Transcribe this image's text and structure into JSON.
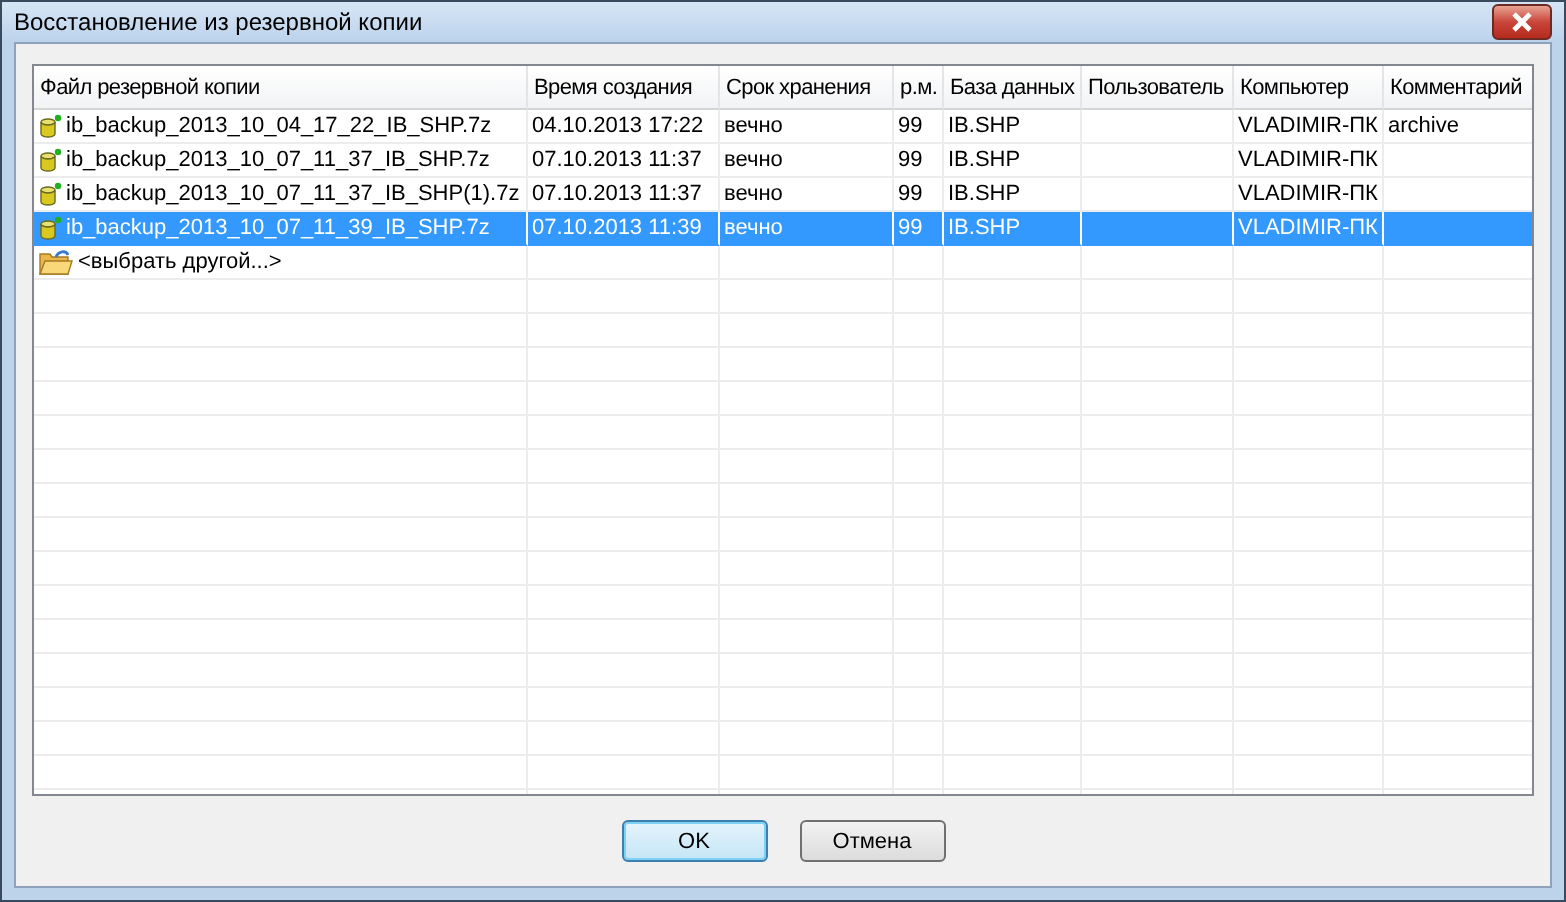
{
  "window": {
    "title": "Восстановление из резервной копии"
  },
  "table": {
    "columns": [
      "Файл резервной копии",
      "Время создания",
      "Срок хранения",
      "р.м.",
      "База данных",
      "Пользователь",
      "Компьютер",
      "Комментарий"
    ],
    "rows": [
      {
        "kind": "file",
        "selected": false,
        "cells": [
          "ib_backup_2013_10_04_17_22_IB_SHP.7z",
          "04.10.2013 17:22",
          "вечно",
          "99",
          "IB.SHP",
          "",
          "VLADIMIR-ПК",
          "archive"
        ]
      },
      {
        "kind": "file",
        "selected": false,
        "cells": [
          "ib_backup_2013_10_07_11_37_IB_SHP.7z",
          "07.10.2013 11:37",
          "вечно",
          "99",
          "IB.SHP",
          "",
          "VLADIMIR-ПК",
          ""
        ]
      },
      {
        "kind": "file",
        "selected": false,
        "cells": [
          "ib_backup_2013_10_07_11_37_IB_SHP(1).7z",
          "07.10.2013 11:37",
          "вечно",
          "99",
          "IB.SHP",
          "",
          "VLADIMIR-ПК",
          ""
        ]
      },
      {
        "kind": "file",
        "selected": true,
        "cells": [
          "ib_backup_2013_10_07_11_39_IB_SHP.7z",
          "07.10.2013 11:39",
          "вечно",
          "99",
          "IB.SHP",
          "",
          "VLADIMIR-ПК",
          ""
        ]
      },
      {
        "kind": "browse",
        "selected": false,
        "cells": [
          "<выбрать другой...>",
          "",
          "",
          "",
          "",
          "",
          "",
          ""
        ]
      }
    ]
  },
  "buttons": [
    {
      "label": "OK",
      "default": true
    },
    {
      "label": "Отмена",
      "default": false
    }
  ]
}
